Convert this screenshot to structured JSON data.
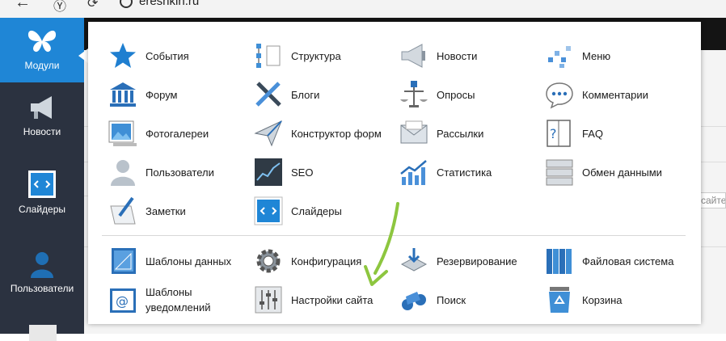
{
  "browser": {
    "url": "ereshkin.ru"
  },
  "sidebar": {
    "items": [
      {
        "label": "Модули",
        "icon": "butterfly-icon",
        "active": true
      },
      {
        "label": "Новости",
        "icon": "megaphone-icon"
      },
      {
        "label": "Слайдеры",
        "icon": "slider-icon"
      },
      {
        "label": "Пользователи",
        "icon": "user-icon"
      }
    ]
  },
  "content": {
    "stub": "сайте"
  },
  "modules": {
    "row1": [
      "События",
      "Структура",
      "Новости",
      "Меню"
    ],
    "row2": [
      "Форум",
      "Блоги",
      "Опросы",
      "Комментарии"
    ],
    "row3": [
      "Фотогалереи",
      "Конструктор форм",
      "Рассылки",
      "FAQ"
    ],
    "row4": [
      "Пользователи",
      "SEO",
      "Статистика",
      "Обмен данными"
    ],
    "row5": [
      "Заметки",
      "Слайдеры"
    ],
    "system1": [
      "Шаблоны данных",
      "Конфигурация",
      "Резервирование",
      "Файловая система"
    ],
    "system2": [
      "Шаблоны уведомлений",
      "Настройки сайта",
      "Поиск",
      "Корзина"
    ]
  },
  "colors": {
    "accent": "#1f86d6",
    "sidebar": "#2b3240",
    "arrow": "#8dc63f"
  }
}
